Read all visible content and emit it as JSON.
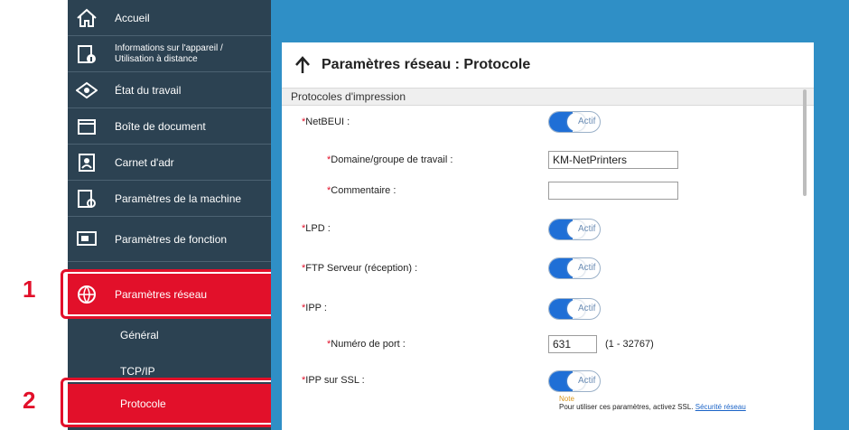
{
  "sidebar": {
    "items": [
      {
        "label": "Accueil",
        "icon": "home-icon"
      },
      {
        "label": "Informations sur l'appareil / Utilisation à distance",
        "icon": "device-info-icon"
      },
      {
        "label": "État du travail",
        "icon": "eye-icon"
      },
      {
        "label": "Boîte de document",
        "icon": "folder-icon"
      },
      {
        "label": "Carnet d'adr",
        "icon": "address-book-icon"
      },
      {
        "label": "Paramètres de la machine",
        "icon": "machine-settings-icon"
      },
      {
        "label": "Paramètres de fonction",
        "icon": "function-settings-icon"
      },
      {
        "label": "Paramètres réseau",
        "icon": "network-globe-icon"
      }
    ],
    "sub_items": [
      {
        "label": "Général"
      },
      {
        "label": "TCP/IP"
      },
      {
        "label": "Protocole"
      }
    ]
  },
  "callouts": {
    "one": "1",
    "two": "2"
  },
  "panel": {
    "title": "Paramètres réseau : Protocole",
    "section": "Protocoles d'impression",
    "rows": {
      "netbeui": "NetBEUI :",
      "domaine": "Domaine/groupe de travail :",
      "commentaire": "Commentaire :",
      "lpd": "LPD :",
      "ftp": "FTP Serveur (réception) :",
      "ipp": "IPP :",
      "port": "Numéro de port :",
      "ippssl": "IPP sur SSL :"
    },
    "req_mark": "*",
    "toggle_label": "Actif",
    "domaine_value": "KM-NetPrinters",
    "commentaire_value": "",
    "port_value": "631",
    "port_range": "(1 - 32767)",
    "note_label": "Note",
    "note_text": "Pour utiliser ces paramètres, activez SSL.",
    "note_link": "Sécurité réseau"
  },
  "colors": {
    "sidebar": "#2c4252",
    "accent": "#e2102a",
    "main_bg": "#2f8fc6",
    "toggle": "#1f6fd6"
  }
}
